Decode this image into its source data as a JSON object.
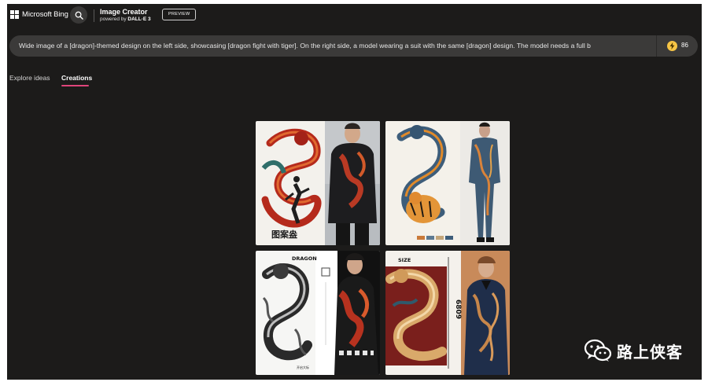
{
  "header": {
    "brand": "Microsoft Bing",
    "product_title": "Image Creator",
    "subtitle_prefix": "powered by ",
    "subtitle_model": "DALL·E 3",
    "badge": "PREVIEW"
  },
  "prompt": {
    "text": "Wide image of a [dragon]-themed design on the left side, showcasing [dragon fight with tiger]. On the right side, a model wearing a suit with the same [dragon] design. The model needs a full b",
    "boost_count": "86"
  },
  "tabs": [
    {
      "label": "Explore ideas",
      "active": false
    },
    {
      "label": "Creations",
      "active": true
    }
  ],
  "images": {
    "card1_text": "图案盎",
    "card2_text": "",
    "card3_text": "DRAGON",
    "card3_footer": "开启大标",
    "card4_text": "SIZE",
    "card4_number": "6809"
  },
  "watermark": {
    "text": "路上侠客"
  },
  "colors": {
    "background": "#1c1b1a",
    "prompt_bar": "#3b3a39",
    "tab_accent": "#e0457b",
    "coin": "#f6c445"
  }
}
